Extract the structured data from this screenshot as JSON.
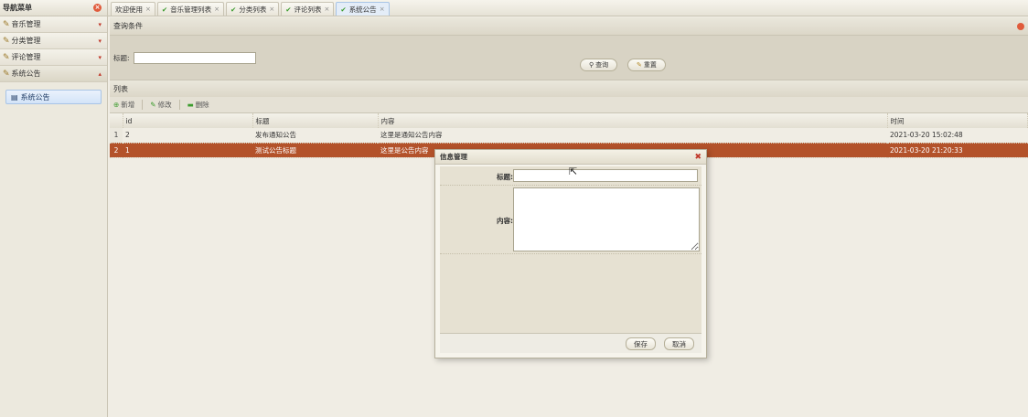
{
  "sidebar": {
    "title": "导航菜单",
    "items": [
      {
        "label": "音乐管理",
        "chevron": "▾"
      },
      {
        "label": "分类管理",
        "chevron": "▾"
      },
      {
        "label": "评论管理",
        "chevron": "▾"
      },
      {
        "label": "系统公告",
        "chevron": "▴"
      }
    ],
    "sub_link": "系统公告"
  },
  "tabs": [
    {
      "label": "欢迎使用"
    },
    {
      "label": "音乐管理列表"
    },
    {
      "label": "分类列表"
    },
    {
      "label": "评论列表"
    },
    {
      "label": "系统公告"
    }
  ],
  "query": {
    "header": "查询条件",
    "title_label": "标题:",
    "title_value": "",
    "search_label": "查询",
    "reset_label": "重置"
  },
  "list": {
    "header": "列表",
    "toolbar": {
      "add": "新增",
      "edit": "修改",
      "delete": "删除"
    },
    "columns": [
      "id",
      "标题",
      "内容",
      "时间"
    ],
    "rows": [
      {
        "rn": "1",
        "id": "2",
        "title": "发布通知公告",
        "content": "这里是通知公告内容",
        "time": "2021-03-20 15:02:48"
      },
      {
        "rn": "2",
        "id": "1",
        "title": "测试公告标题",
        "content": "这里是公告内容",
        "time": "2021-03-20 21:20:33"
      }
    ]
  },
  "dialog": {
    "title": "信息管理",
    "title_label": "标题:",
    "content_label": "内容:",
    "save_label": "保存",
    "cancel_label": "取消"
  },
  "colors": {
    "selected_row": "#b3522a",
    "accent_blue": "#a8c4e6"
  }
}
